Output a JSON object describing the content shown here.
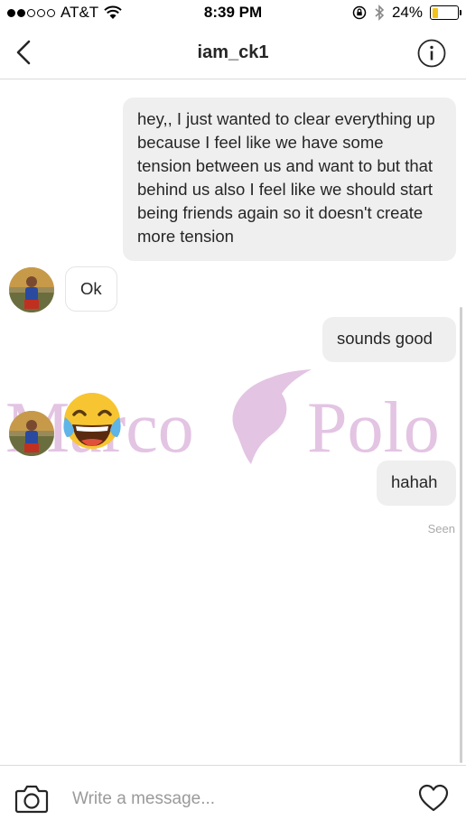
{
  "status_bar": {
    "carrier": "AT&T",
    "time": "8:39 PM",
    "battery_percent": "24%",
    "battery_level": 0.24,
    "battery_color": "#f2c518",
    "icons": [
      "signal-dots-icon",
      "wifi-icon",
      "rotation-lock-icon",
      "bluetooth-icon",
      "battery-icon"
    ]
  },
  "header": {
    "title": "iam_ck1",
    "back_icon": "chevron-left-icon",
    "info_icon": "info-circle-icon"
  },
  "messages": [
    {
      "direction": "outgoing",
      "text": "hey,, I just wanted to clear everything up because I feel like we have some tension between us and want to but that behind us also I feel like we should start being friends again so it doesn't create more tension"
    },
    {
      "direction": "incoming",
      "text": "Ok"
    },
    {
      "direction": "outgoing",
      "text": "sounds good"
    },
    {
      "direction": "incoming",
      "text": "😂"
    },
    {
      "direction": "outgoing",
      "text": "hahah"
    }
  ],
  "seen_label": "Seen",
  "watermark": {
    "left_text": "Marco",
    "right_text": "Polo",
    "color": "#e3c4e3"
  },
  "composer": {
    "placeholder": "Write a message...",
    "camera_icon": "camera-icon",
    "heart_icon": "heart-icon"
  }
}
